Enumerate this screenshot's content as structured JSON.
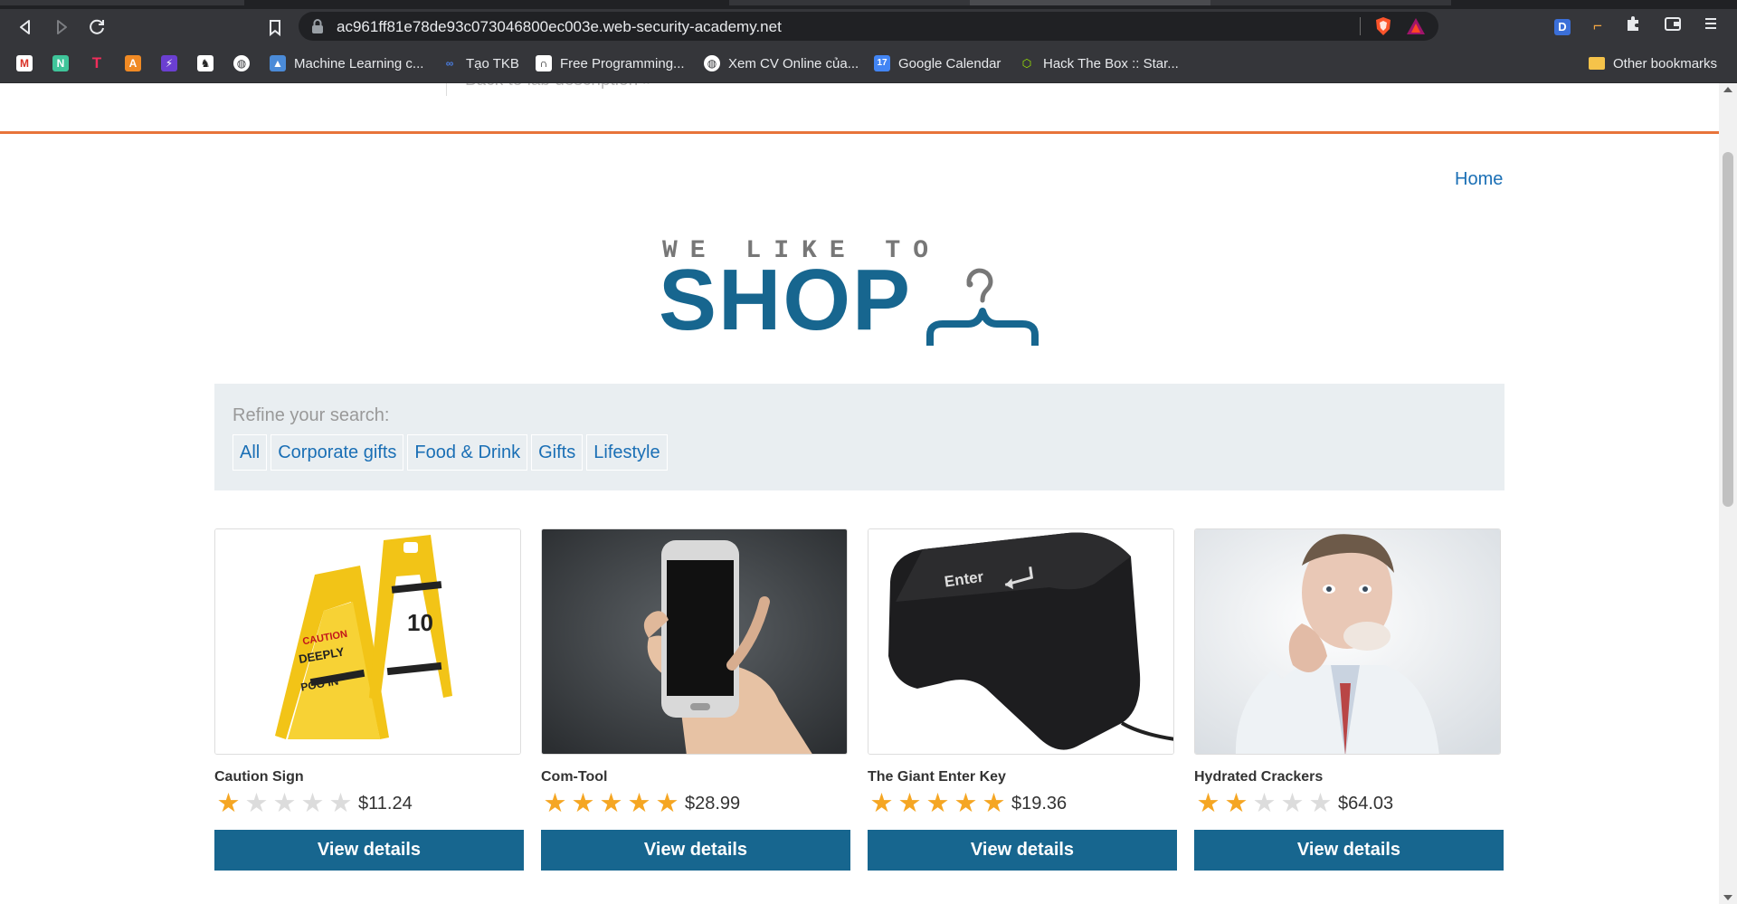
{
  "browser": {
    "url": "ac961ff81e78de93c073046800ec003e.web-security-academy.net",
    "bookmarks": [
      {
        "label": "",
        "icon": "gmail-icon"
      },
      {
        "label": "",
        "icon": "n-app-icon"
      },
      {
        "label": "",
        "icon": "t-app-icon"
      },
      {
        "label": "",
        "icon": "a-app-icon"
      },
      {
        "label": "",
        "icon": "bolt-icon"
      },
      {
        "label": "",
        "icon": "chess-icon"
      },
      {
        "label": "",
        "icon": "globe-icon"
      },
      {
        "label": "Machine Learning c...",
        "icon": "course-icon"
      },
      {
        "label": "Tạo TKB",
        "icon": "link-icon"
      },
      {
        "label": "Free Programming...",
        "icon": "book-icon"
      },
      {
        "label": "Xem CV Online của...",
        "icon": "globe-icon"
      },
      {
        "label": "Google Calendar",
        "icon": "calendar-icon"
      },
      {
        "label": "Hack The Box :: Star...",
        "icon": "htb-icon"
      }
    ],
    "other_bookmarks": "Other bookmarks"
  },
  "lab": {
    "back_link": "Back to lab description »"
  },
  "nav": {
    "home": "Home"
  },
  "logo": {
    "tagline": "WE LIKE TO",
    "word": "SHOP"
  },
  "refine": {
    "label": "Refine your search:",
    "filters": [
      "All",
      "Corporate gifts",
      "Food & Drink",
      "Gifts",
      "Lifestyle"
    ]
  },
  "products": [
    {
      "name": "Caution Sign",
      "rating": 1,
      "price": "$11.24",
      "button": "View details"
    },
    {
      "name": "Com-Tool",
      "rating": 5,
      "price": "$28.99",
      "button": "View details"
    },
    {
      "name": "The Giant Enter Key",
      "rating": 5,
      "price": "$19.36",
      "button": "View details"
    },
    {
      "name": "Hydrated Crackers",
      "rating": 2,
      "price": "$64.03",
      "button": "View details"
    }
  ],
  "colors": {
    "accent": "#17668f",
    "link": "#1a6fb5",
    "header_line": "#e8743b",
    "star": "#f5a623"
  }
}
